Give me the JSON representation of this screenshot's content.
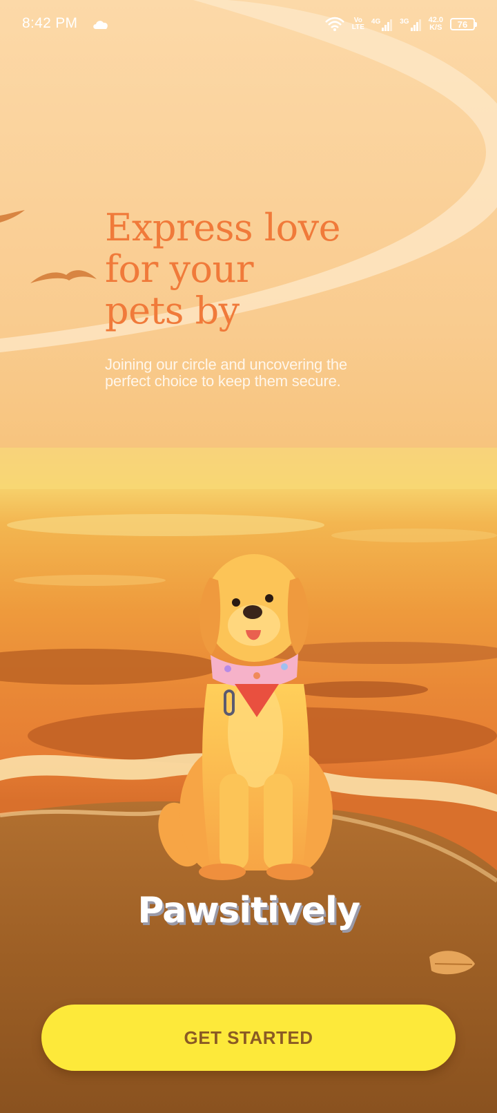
{
  "status_bar": {
    "time": "8:42 PM",
    "weather_icon": "cloud-icon",
    "wifi_icon": "wifi-icon",
    "volte_top": "Vo",
    "volte_bottom": "LTE",
    "sim1_network": "4G",
    "sim2_network": "3G",
    "speed_value": "42.0",
    "speed_unit": "K/S",
    "battery": "76"
  },
  "onboarding": {
    "headline_lines": [
      "Express love",
      "for your",
      "pets by"
    ],
    "subtext_lines": [
      "Joining our circle and uncovering the",
      "perfect choice to keep them secure."
    ],
    "brand_name": "Pawsitively",
    "cta_label": "GET STARTED"
  },
  "colors": {
    "headline": "#f07a3a",
    "cta_background": "#fde93a",
    "cta_text": "#8a5a24",
    "sky_top": "#fbd5a2",
    "sand": "#9b5c22"
  }
}
